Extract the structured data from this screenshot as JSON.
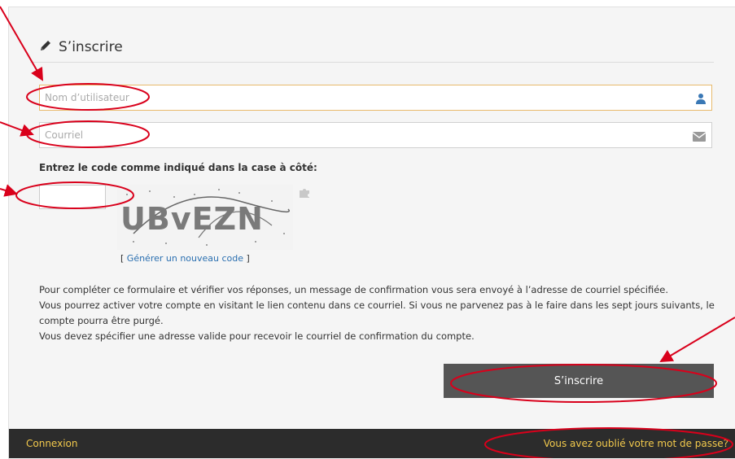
{
  "form": {
    "title": "S’inscrire",
    "username_placeholder": "Nom d’utilisateur",
    "email_placeholder": "Courriel",
    "captcha_label": "Entrez le code comme indiqué dans la case à côté:",
    "captcha_text": "UBvEZN",
    "regenerate_open": "[ ",
    "regenerate_link": "Générer un nouveau code",
    "regenerate_close": " ]",
    "description": [
      "Pour compléter ce formulaire et vérifier vos réponses, un message de confirmation vous sera envoyé à l’adresse de courriel spécifiée.",
      "Vous pourrez activer votre compte en visitant le lien contenu dans ce courriel. Si vous ne parvenez pas à le faire dans les sept jours suivants, le compte pourra être purgé.",
      "Vous devez spécifier une adresse valide pour recevoir le courriel de confirmation du compte."
    ],
    "submit_label": "S’inscrire"
  },
  "footer": {
    "login_link": "Connexion",
    "forgot_link": "Vous avez oublié votre mot de passe?"
  },
  "colors": {
    "annotation": "#d9001b",
    "footer_link": "#f2c94c",
    "button_bg": "#555555"
  }
}
